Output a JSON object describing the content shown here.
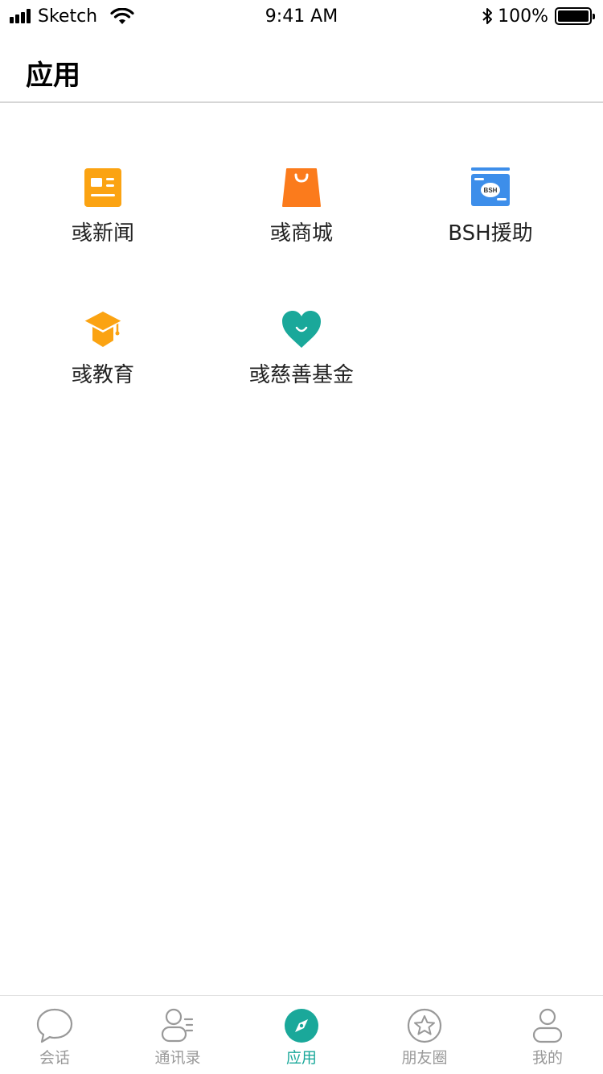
{
  "status_bar": {
    "carrier": "Sketch",
    "time": "9:41 AM",
    "battery": "100%"
  },
  "header": {
    "title": "应用"
  },
  "apps": [
    {
      "label": "彧新闻",
      "icon": "news-icon",
      "color": "#FBA312"
    },
    {
      "label": "彧商城",
      "icon": "shopping-bag-icon",
      "color": "#FB7B1C"
    },
    {
      "label": "BSH援助",
      "icon": "bsh-card-icon",
      "color": "#3D8EEA",
      "icon_text": "BSH"
    },
    {
      "label": "彧教育",
      "icon": "graduation-cap-icon",
      "color": "#FBA312"
    },
    {
      "label": "彧慈善基金",
      "icon": "heart-smile-icon",
      "color": "#1AA89A"
    }
  ],
  "tabbar": {
    "active_color": "#1AA89A",
    "inactive_color": "#999999",
    "items": [
      {
        "label": "会话",
        "icon": "chat-bubble-icon",
        "active": false
      },
      {
        "label": "通讯录",
        "icon": "contacts-icon",
        "active": false
      },
      {
        "label": "应用",
        "icon": "compass-icon",
        "active": true
      },
      {
        "label": "朋友圈",
        "icon": "star-circle-icon",
        "active": false
      },
      {
        "label": "我的",
        "icon": "person-icon",
        "active": false
      }
    ]
  }
}
